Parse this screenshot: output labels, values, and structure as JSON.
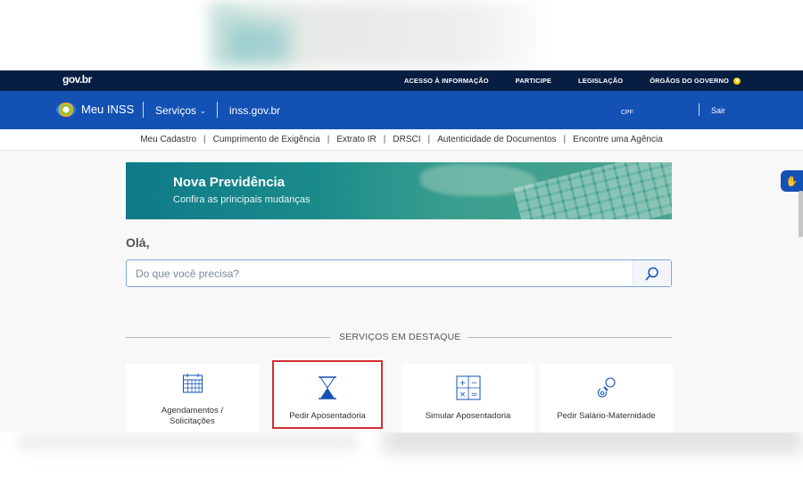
{
  "topbar": {
    "logo": "gov.br",
    "links": [
      "ACESSO À INFORMAÇÃO",
      "PARTICIPE",
      "LEGISLAÇÃO",
      "ÓRGÃOS DO GOVERNO"
    ]
  },
  "header": {
    "brand": "Meu INSS",
    "services": "Serviços",
    "site": "inss.gov.br",
    "cpf": "CPF",
    "logout": "Sair"
  },
  "subnav": [
    "Meu Cadastro",
    "Cumprimento de Exigência",
    "Extrato IR",
    "DRSCI",
    "Autenticidade de Documentos",
    "Encontre uma Agência"
  ],
  "banner": {
    "title": "Nova Previdência",
    "subtitle": "Confira as principais mudanças"
  },
  "greeting": "Olá,",
  "search": {
    "placeholder": "Do que você precisa?"
  },
  "featured": {
    "title": "SERVIÇOS EM DESTAQUE",
    "cards": [
      {
        "label": "Agendamentos / Solicitações",
        "icon": "calendar-icon"
      },
      {
        "label": "Pedir Aposentadoria",
        "icon": "hourglass-icon"
      },
      {
        "label": "Simular Aposentadoria",
        "icon": "calculator-icon"
      },
      {
        "label": "Pedir Salário-Maternidade",
        "icon": "pacifier-icon"
      }
    ]
  },
  "colors": {
    "topbar": "#071d41",
    "header": "#1351b4",
    "highlight": "#d32f2f"
  }
}
